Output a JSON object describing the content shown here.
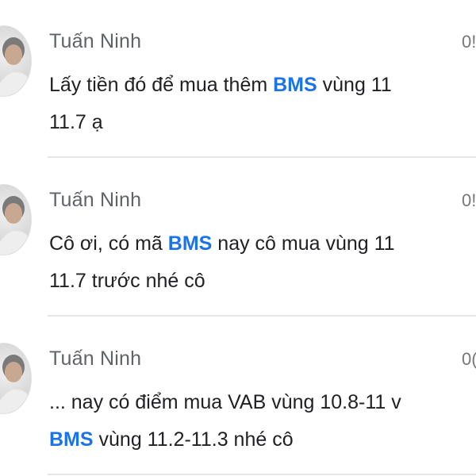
{
  "messages": [
    {
      "sender": "Tuấn Ninh",
      "time": "0!",
      "lines": [
        [
          {
            "text": "Lấy tiền đó để mua thêm ",
            "highlight": false
          },
          {
            "text": "BMS",
            "highlight": true
          },
          {
            "text": " vùng 11",
            "highlight": false
          }
        ],
        [
          {
            "text": "11.7 ạ",
            "highlight": false
          }
        ]
      ]
    },
    {
      "sender": "Tuấn Ninh",
      "time": "0!",
      "lines": [
        [
          {
            "text": "Cô ơi, có mã ",
            "highlight": false
          },
          {
            "text": "BMS",
            "highlight": true
          },
          {
            "text": " nay cô mua vùng 11",
            "highlight": false
          }
        ],
        [
          {
            "text": "11.7 trước nhé cô",
            "highlight": false
          }
        ]
      ]
    },
    {
      "sender": "Tuấn Ninh",
      "time": "0(",
      "lines": [
        [
          {
            "text": "... nay có điểm mua VAB vùng 10.8-11 v",
            "highlight": false
          }
        ],
        [
          {
            "text": "BMS",
            "highlight": true
          },
          {
            "text": " vùng 11.2-11.3 nhé cô",
            "highlight": false
          }
        ]
      ]
    }
  ],
  "colors": {
    "highlight": "#1a73e8",
    "sender": "#5f6368",
    "body_text": "#202124",
    "divider": "#e6e6e6"
  }
}
